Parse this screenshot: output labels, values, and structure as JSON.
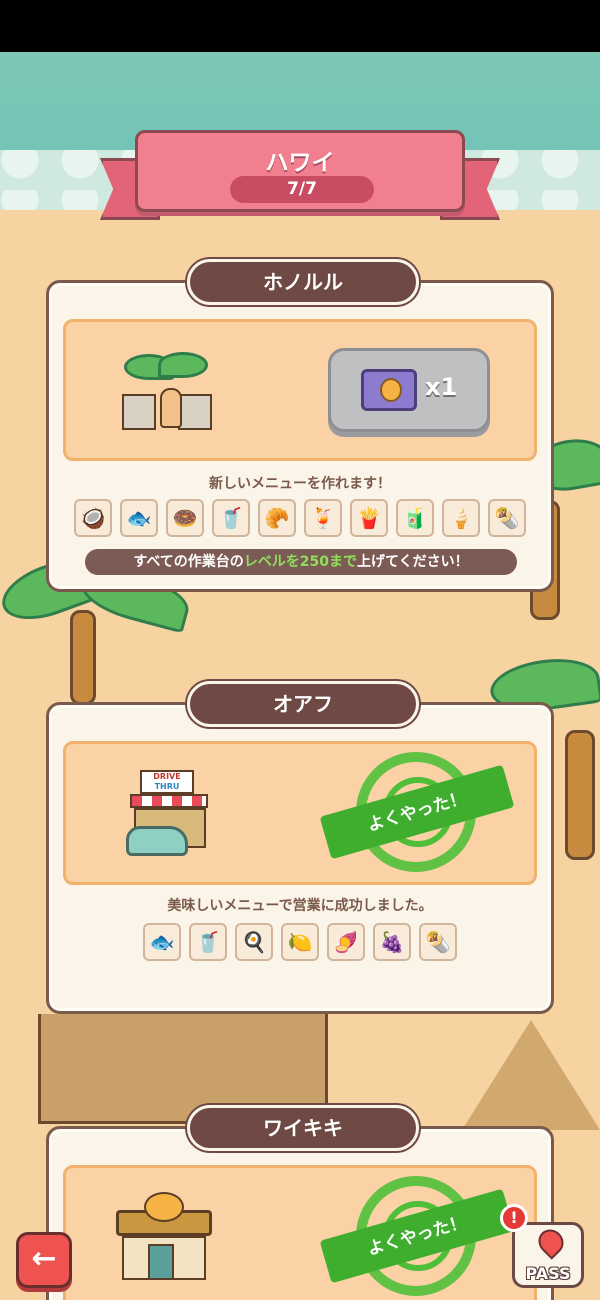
{
  "header": {
    "title": "ハワイ",
    "progress": "7/7"
  },
  "stages": [
    {
      "name": "ホノルル",
      "reward_qty": "x1",
      "description": "新しいメニューを作れます！",
      "menu_icons": [
        "coconut-icon",
        "taiyaki-icon",
        "donut-icon",
        "pink-drink-icon",
        "croissant-icon",
        "red-drink-icon",
        "fries-icon",
        "blue-drink-icon",
        "ice-cream-icon",
        "crepe-icon"
      ],
      "hint": {
        "pre": "すべての作業台の",
        "hl": "レベルを250まで",
        "post": "上げてください！"
      }
    },
    {
      "name": "オアフ",
      "stamp": "よくやった！",
      "building_sign": "DRIVE",
      "building_sub": "THRU",
      "description": "美味しいメニューで営業に成功しました。",
      "menu_icons": [
        "taiyaki-icon",
        "juice-icon",
        "egg-icon",
        "lemonade-icon",
        "purple-bread-icon",
        "purple-pastry-icon",
        "crepe-icon"
      ]
    },
    {
      "name": "ワイキキ",
      "stamp": "よくやった！"
    }
  ],
  "buttons": {
    "back": "←",
    "pass": "PASS",
    "alert": "!"
  }
}
